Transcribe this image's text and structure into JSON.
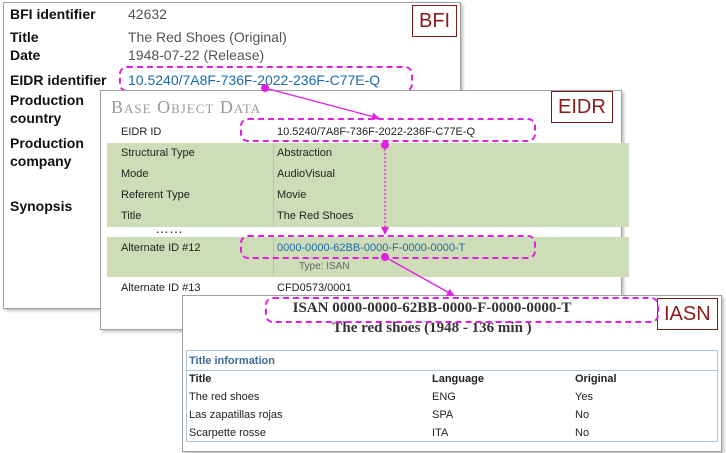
{
  "bfi": {
    "tag": "BFI",
    "fields": [
      {
        "label": "BFI identifier",
        "value": "42632"
      },
      {
        "label": "Title",
        "value": "The Red Shoes (Original)"
      },
      {
        "label": "Date",
        "value": "1948-07-22 (Release)"
      },
      {
        "label": "EIDR identifier",
        "value": "10.5240/7A8F-736F-2022-236F-C77E-Q"
      },
      {
        "label": "Production country",
        "value": ""
      },
      {
        "label": "Production company",
        "value": ""
      },
      {
        "label": "Synopsis",
        "value": ""
      }
    ]
  },
  "eidr": {
    "tag": "EIDR",
    "title": "Base Object Data",
    "rows": [
      {
        "key": "EIDR ID",
        "value": "10.5240/7A8F-736F-2022-236F-C77E-Q"
      },
      {
        "key": "Structural Type",
        "value": "Abstraction"
      },
      {
        "key": "Mode",
        "value": "AudioVisual"
      },
      {
        "key": "Referent Type",
        "value": "Movie"
      },
      {
        "key": "Title",
        "value": "The Red Shoes"
      }
    ],
    "ellipsis": "……",
    "alternate12": {
      "key": "Alternate ID #12",
      "value": "0000-0000-62BB-0000-F-0000-0000-T",
      "type": "Type: ISAN"
    },
    "alternate13": {
      "key": "Alternate ID #13",
      "value": "CFD0573/0001"
    }
  },
  "iasn": {
    "tag": "IASN",
    "isan": "ISAN 0000-0000-62BB-0000-F-0000-0000-T",
    "subtitle": "The red shoes (1948 - 136 min )",
    "section": "Title information",
    "columns": [
      "Title",
      "Language",
      "Original"
    ],
    "rows": [
      [
        "The red shoes",
        "ENG",
        "Yes"
      ],
      [
        "Las zapatillas rojas",
        "SPA",
        "No"
      ],
      [
        "Scarpette rosse",
        "ITA",
        "No"
      ]
    ]
  },
  "colors": {
    "connector": "#e020e0",
    "tag_border": "#7a1a1a",
    "link": "#1a6aa8",
    "green_row": "#cfdcb8"
  }
}
